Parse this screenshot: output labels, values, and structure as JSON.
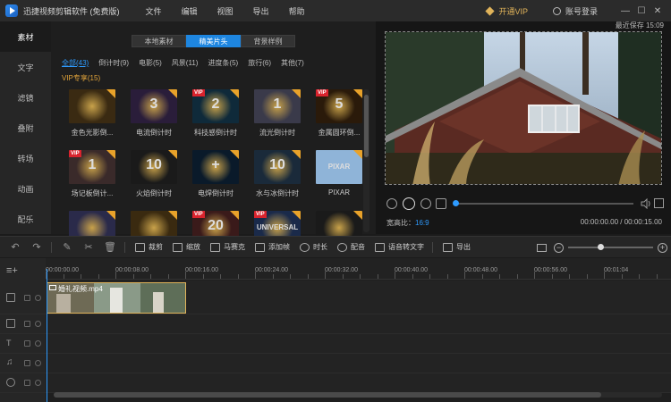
{
  "titlebar": {
    "app_title": "迅捷视频剪辑软件 (免费版)",
    "menu": [
      "文件",
      "编辑",
      "视图",
      "导出",
      "帮助"
    ],
    "vip_label": "开通VIP",
    "login_label": "账号登录",
    "window_controls": [
      "minimize-icon",
      "maximize-icon",
      "close-icon"
    ]
  },
  "leftnav": {
    "items": [
      "素材",
      "文字",
      "滤镜",
      "叠附",
      "转场",
      "动画",
      "配乐"
    ],
    "active": "素材"
  },
  "library": {
    "tabs": [
      "本地素材",
      "精美片头",
      "背景样例"
    ],
    "active_tab": "精美片头",
    "categories": [
      "全部(43)",
      "倒计时(9)",
      "电影(5)",
      "风景(11)",
      "进度条(5)",
      "旅行(6)",
      "其他(7)"
    ],
    "active_category": "全部(43)",
    "vip_category": "VIP专享(15)",
    "items": [
      {
        "label": "金色光影倒...",
        "vip": false,
        "num": ""
      },
      {
        "label": "电流倒计时",
        "vip": false,
        "num": "3"
      },
      {
        "label": "科技感倒计时",
        "vip": true,
        "num": "2"
      },
      {
        "label": "流光倒计时",
        "vip": false,
        "num": "1"
      },
      {
        "label": "金属圆环倒...",
        "vip": true,
        "num": "5"
      },
      {
        "label": "场记板倒计...",
        "vip": true,
        "num": "1"
      },
      {
        "label": "火焰倒计时",
        "vip": false,
        "num": "10"
      },
      {
        "label": "电焊倒计时",
        "vip": false,
        "num": "+"
      },
      {
        "label": "水与冰倒计时",
        "vip": false,
        "num": "10"
      },
      {
        "label": "PIXAR",
        "vip": false,
        "num": "PIXAR"
      },
      {
        "label": "",
        "vip": false,
        "num": ""
      },
      {
        "label": "",
        "vip": false,
        "num": ""
      },
      {
        "label": "",
        "vip": true,
        "num": "20"
      },
      {
        "label": "",
        "vip": true,
        "num": "UNIVERSAL"
      },
      {
        "label": "",
        "vip": false,
        "num": ""
      }
    ]
  },
  "preview": {
    "autosave": "最近保存 15:09",
    "aspect_label": "宽高比：",
    "aspect_value": "16:9",
    "timecode": "00:00:00.00 / 00:00:15.00",
    "progress": 0.0
  },
  "toolbar": {
    "tools": [
      "裁剪",
      "缩放",
      "马赛克",
      "添加帧",
      "时长",
      "配音",
      "语音转文字",
      "导出"
    ],
    "zoom_level": 0.38
  },
  "timeline": {
    "ticks": [
      "00:00:00.00",
      "00:00:08.00",
      "00:00:16.00",
      "00:00:24.00",
      "00:00:32.00",
      "00:00:40.00",
      "00:00:48.00",
      "00:00:56.00",
      "00:01:04"
    ],
    "clip_label": "婚礼视频.mp4"
  }
}
